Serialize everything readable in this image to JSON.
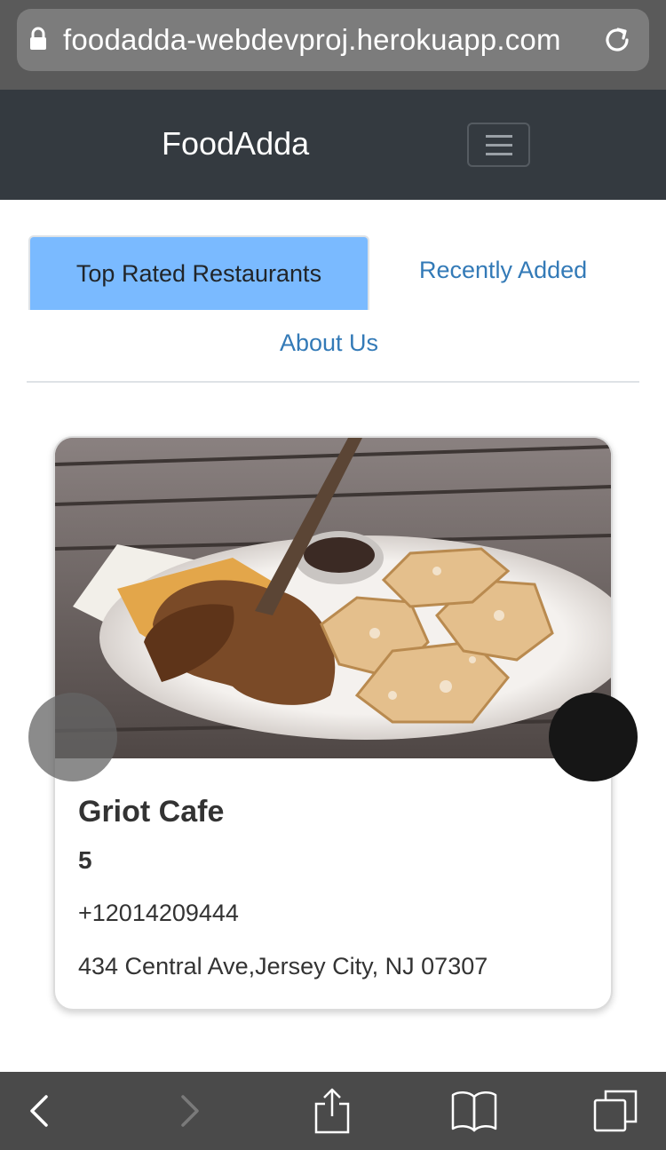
{
  "browser": {
    "url": "foodadda-webdevproj.herokuapp.com",
    "lock_icon": "lock-icon",
    "reload_icon": "reload-icon"
  },
  "navbar": {
    "brand": "FoodAdda",
    "toggler_icon": "hamburger-icon",
    "background": "#343a40"
  },
  "tabs": {
    "active": "Top Rated Restaurants",
    "recently_added": "Recently Added",
    "about_us": "About Us",
    "active_color": "#7abaff",
    "link_color": "#337ab7"
  },
  "restaurant": {
    "name": "Griot Cafe",
    "rating": "5",
    "phone": "+12014209444",
    "address": "434 Central Ave,Jersey City, NJ 07307"
  },
  "toolbar": {
    "icons": [
      "back-icon",
      "forward-icon",
      "share-icon",
      "bookmarks-icon",
      "tabs-icon"
    ]
  }
}
